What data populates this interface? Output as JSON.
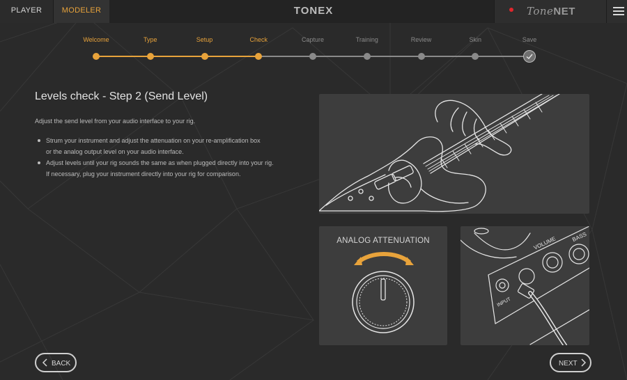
{
  "tabs": {
    "player": "PLAYER",
    "modeler": "MODELER"
  },
  "app_logo": "TONEX",
  "tonenet": {
    "script": "Tone",
    "bold": "NET"
  },
  "colors": {
    "accent": "#e8a33b",
    "inactive": "#8a8a8a",
    "record": "#e0262c"
  },
  "stepper": {
    "current_step": "Check",
    "steps": [
      {
        "label": "Welcome",
        "state": "done"
      },
      {
        "label": "Type",
        "state": "done"
      },
      {
        "label": "Setup",
        "state": "done"
      },
      {
        "label": "Check",
        "state": "current"
      },
      {
        "label": "Capture",
        "state": "pending"
      },
      {
        "label": "Training",
        "state": "pending"
      },
      {
        "label": "Review",
        "state": "pending"
      },
      {
        "label": "Skin",
        "state": "pending"
      },
      {
        "label": "Save",
        "state": "final-check"
      }
    ]
  },
  "content": {
    "title": "Levels check - Step 2 (Send Level)",
    "intro": "Adjust the send level from your audio interface to your rig.",
    "bullets": [
      {
        "line1": "Strum your instrument and adjust the attenuation on your re-amplification box",
        "line2": "or the analog output level on your audio interface."
      },
      {
        "line1": "Adjust levels until your rig sounds the same as when plugged directly into your rig.",
        "line2": "If necessary, plug your instrument directly into your rig for comparison."
      }
    ]
  },
  "illustrations": {
    "attenuation_title": "ANALOG ATTENUATION",
    "amp_labels": {
      "volume": "VOLUME",
      "bass": "BASS",
      "input": "INPUT"
    }
  },
  "nav": {
    "back": "BACK",
    "next": "NEXT"
  }
}
